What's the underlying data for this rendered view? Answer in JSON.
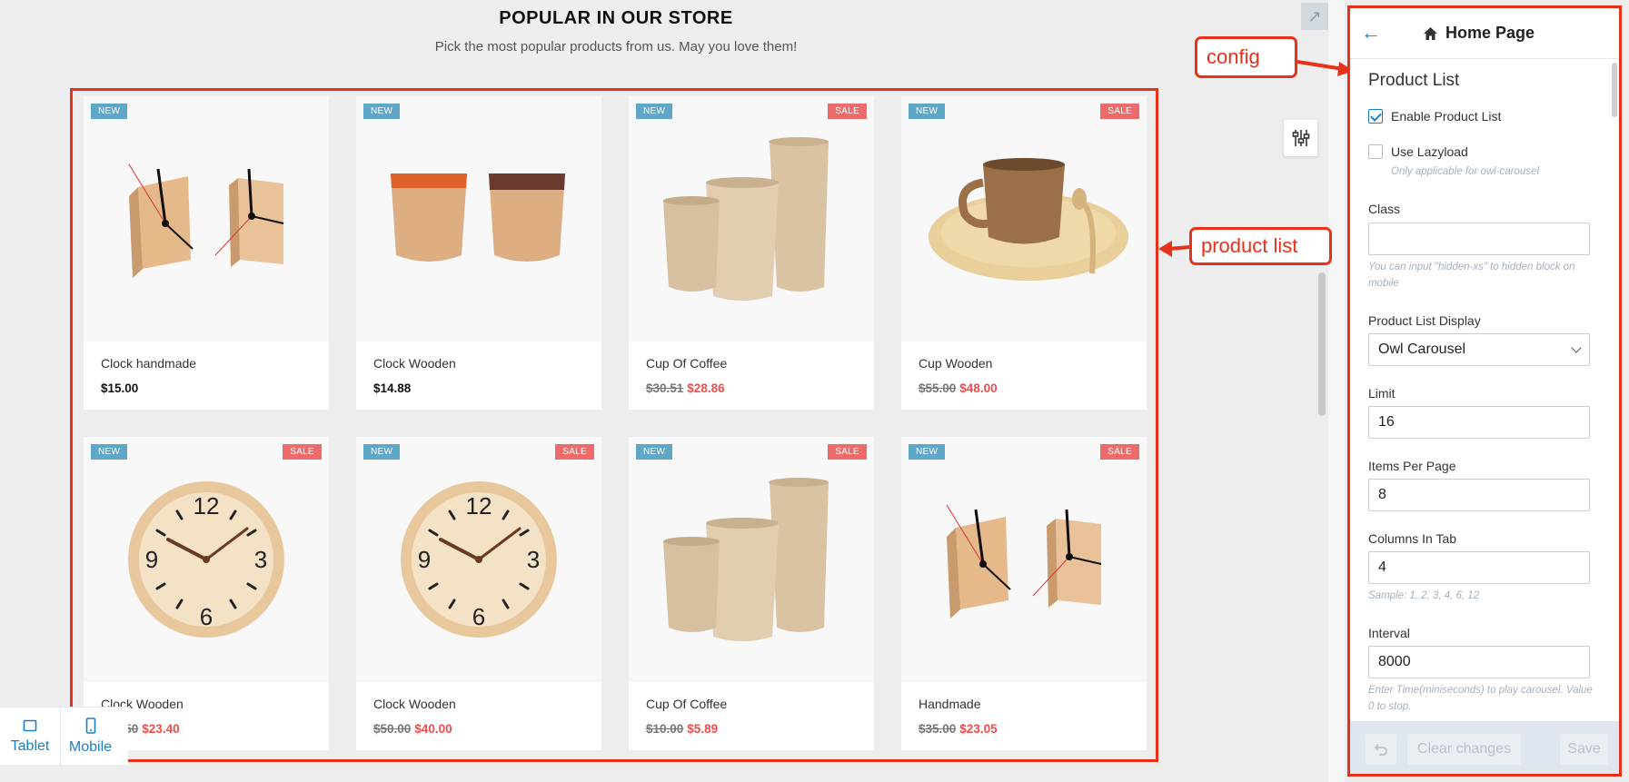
{
  "store": {
    "title": "POPULAR IN OUR STORE",
    "subtitle": "Pick the most popular products from us. May you love them!"
  },
  "products": [
    {
      "name": "Clock handmade",
      "badge_new": "NEW",
      "badge_sale": "",
      "old_price": "",
      "price": "$15.00",
      "image": "wooden-block-clock"
    },
    {
      "name": "Clock Wooden",
      "badge_new": "NEW",
      "badge_sale": "",
      "old_price": "",
      "price": "$14.88",
      "image": "wooden-cups"
    },
    {
      "name": "Cup Of Coffee",
      "badge_new": "NEW",
      "badge_sale": "SALE",
      "old_price": "$30.51",
      "price": "$28.86",
      "image": "wooden-tumblers"
    },
    {
      "name": "Cup Wooden",
      "badge_new": "NEW",
      "badge_sale": "SALE",
      "old_price": "$55.00",
      "price": "$48.00",
      "image": "wooden-mug-plate"
    },
    {
      "name": "Clock Wooden",
      "badge_new": "NEW",
      "badge_sale": "SALE",
      "old_price": "$31.50",
      "price": "$23.40",
      "image": "wall-clock"
    },
    {
      "name": "Clock Wooden",
      "badge_new": "NEW",
      "badge_sale": "SALE",
      "old_price": "$50.00",
      "price": "$40.00",
      "image": "wall-clock"
    },
    {
      "name": "Cup Of Coffee",
      "badge_new": "NEW",
      "badge_sale": "SALE",
      "old_price": "$10.00",
      "price": "$5.89",
      "image": "wooden-tumblers"
    },
    {
      "name": "Handmade",
      "badge_new": "NEW",
      "badge_sale": "SALE",
      "old_price": "$35.00",
      "price": "$23.05",
      "image": "wooden-block-clock"
    }
  ],
  "annotations": {
    "config": "config",
    "product_list": "product list"
  },
  "devices": {
    "tablet": "Tablet",
    "mobile": "Mobile"
  },
  "panel": {
    "title": "Home Page",
    "section": "Product List",
    "enable_label": "Enable Product List",
    "enable_checked": true,
    "lazyload_label": "Use Lazyload",
    "lazyload_checked": false,
    "lazyload_help": "Only applicable for owl-carousel",
    "class_label": "Class",
    "class_value": "",
    "class_help": "You can input \"hidden-xs\" to hidden block on mobile",
    "display_label": "Product List Display",
    "display_value": "Owl Carousel",
    "limit_label": "Limit",
    "limit_value": "16",
    "per_page_label": "Items Per Page",
    "per_page_value": "8",
    "columns_label": "Columns In Tab",
    "columns_value": "4",
    "columns_help": "Sample: 1, 2, 3, 4, 6, 12",
    "interval_label": "Interval",
    "interval_value": "8000",
    "interval_help": "Enter Time(miniseconds) to play carousel. Value 0 to stop.",
    "clear_label": "Clear changes",
    "save_label": "Save"
  },
  "colors": {
    "accent": "#1a7fc1",
    "annotation": "#e8311a",
    "badge_new": "#5fa7c9",
    "badge_sale": "#ee6b6b",
    "sale_price": "#ee4c4c"
  }
}
